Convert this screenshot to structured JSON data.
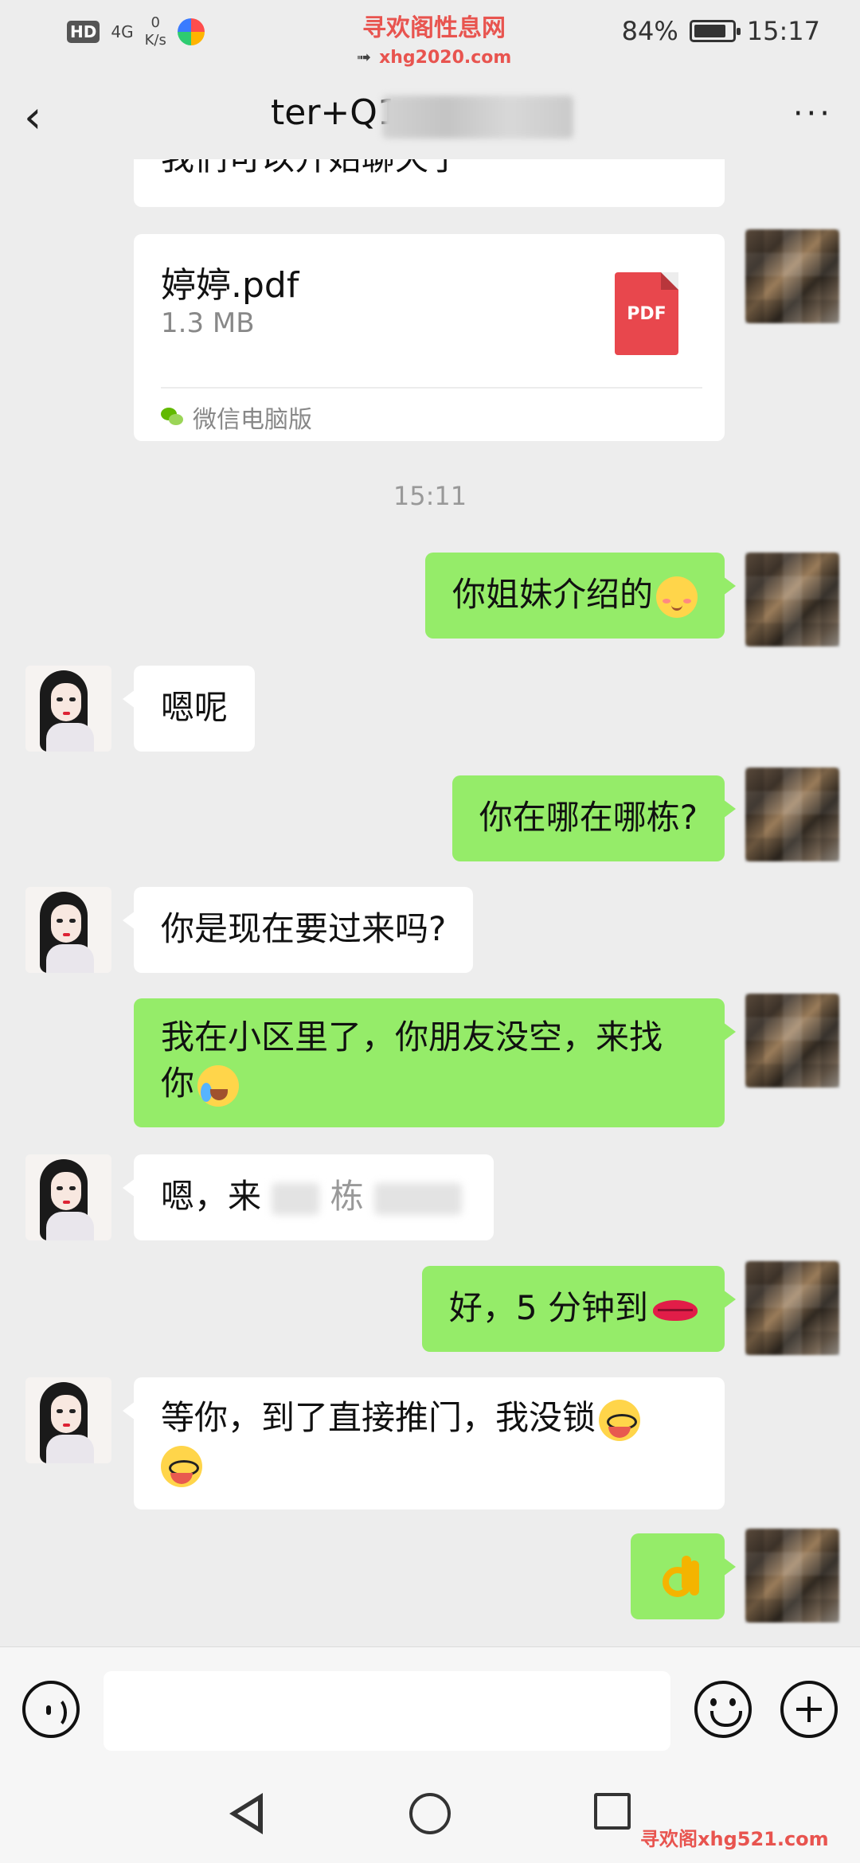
{
  "status_bar": {
    "hd": "HD",
    "network": "4G",
    "net_speed_value": "0",
    "net_speed_unit": "K/s",
    "battery": "84%",
    "battery_level": 0.84,
    "time": "15:17"
  },
  "watermark": {
    "site_name": "寻欢阁性息网",
    "site_url": "xhg2020.com",
    "bottom": "寻欢阁xhg521.com"
  },
  "header": {
    "title": "ter+Q1",
    "more": "···"
  },
  "messages": {
    "top_partial": "我们可以开始聊天了",
    "file": {
      "name": "婷婷.pdf",
      "size": "1.3 MB",
      "type": "PDF",
      "source": "微信电脑版"
    },
    "time_divider": "15:11",
    "m1": "你姐妹介绍的",
    "m2": "嗯呢",
    "m3": "你在哪在哪栋?",
    "m4": "你是现在要过来吗?",
    "m5a": "我在小区里了，你朋友没空，来找",
    "m5b": "你",
    "m6a": "嗯，来",
    "m6b": "栋",
    "m7": "好，5 分钟到",
    "m8a": "等你，到了直接推门，我没锁",
    "icons": {
      "m1": "blushing-face-emoji",
      "m5": "crying-face-emoji",
      "m7": "kiss-lips-emoji",
      "m8": "shy-face-emoji",
      "m9": "ok-hand-emoji"
    }
  },
  "input_bar": {
    "placeholder": ""
  }
}
